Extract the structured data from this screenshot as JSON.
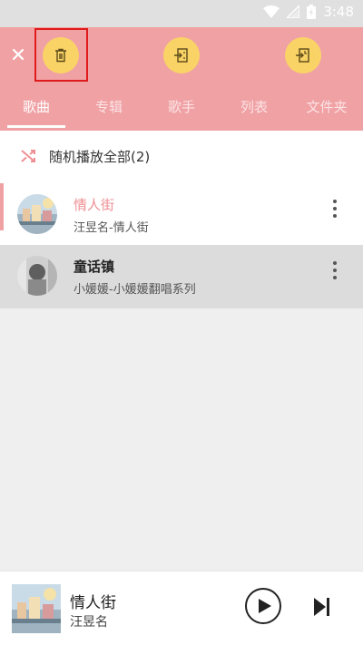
{
  "status_bar": {
    "time": "3:48"
  },
  "header": {
    "close_icon": "close-icon",
    "actions": [
      {
        "icon": "trash-icon"
      },
      {
        "icon": "add-to-playlist-icon"
      },
      {
        "icon": "add-to-queue-icon"
      }
    ],
    "tabs": [
      {
        "label": "歌曲",
        "active": true
      },
      {
        "label": "专辑",
        "active": false
      },
      {
        "label": "歌手",
        "active": false
      },
      {
        "label": "列表",
        "active": false
      },
      {
        "label": "文件夹",
        "active": false
      }
    ]
  },
  "shuffle": {
    "label": "随机播放全部(2)",
    "icon": "shuffle-icon"
  },
  "songs": [
    {
      "title": "情人街",
      "subtitle": "汪昱名-情人街"
    },
    {
      "title": "童话镇",
      "subtitle": "小媛媛-小媛媛翻唱系列"
    }
  ],
  "player": {
    "title": "情人街",
    "artist": "汪昱名"
  },
  "colors": {
    "accent": "#f0a1a4",
    "action": "#fad366",
    "highlight": "#e01b1b"
  }
}
